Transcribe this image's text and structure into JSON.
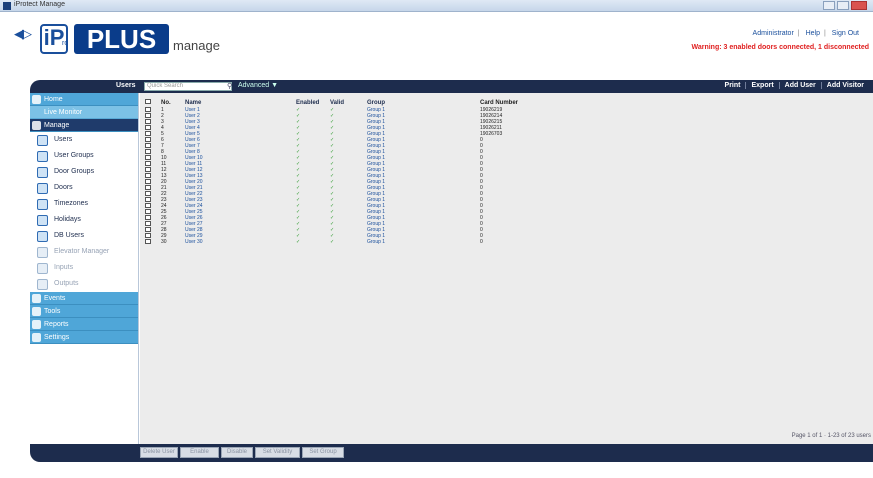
{
  "window": {
    "title": "iProtect Manage"
  },
  "header": {
    "logo_ip": "iP",
    "logo_ro": "ro",
    "logo_plus": "PLUS",
    "logo_manage": "manage",
    "links": [
      "Administrator",
      "Help",
      "Sign Out"
    ],
    "warning": "Warning: 3 enabled doors connected, 1 disconnected"
  },
  "toolbar": {
    "users_label": "Users",
    "search_placeholder": "Quick Search",
    "advanced_label": "Advanced ▼",
    "actions": [
      "Print",
      "Export",
      "Add User",
      "Add Visitor"
    ]
  },
  "sidebar": {
    "top_sections": [
      "Home",
      "Live Monitor"
    ],
    "active_section": "Manage",
    "items": [
      {
        "label": "Users",
        "icon": "users-icon",
        "dim": false
      },
      {
        "label": "User Groups",
        "icon": "user-groups-icon",
        "dim": false
      },
      {
        "label": "Door Groups",
        "icon": "door-groups-icon",
        "dim": false
      },
      {
        "label": "Doors",
        "icon": "doors-icon",
        "dim": false
      },
      {
        "label": "Timezones",
        "icon": "clock-icon",
        "dim": false
      },
      {
        "label": "Holidays",
        "icon": "calendar-icon",
        "dim": false
      },
      {
        "label": "DB Users",
        "icon": "db-users-icon",
        "dim": false
      },
      {
        "label": "Elevator Manager",
        "icon": "elevator-icon",
        "dim": true
      },
      {
        "label": "Inputs",
        "icon": "inputs-icon",
        "dim": true
      },
      {
        "label": "Outputs",
        "icon": "outputs-icon",
        "dim": true
      }
    ],
    "bottom_sections": [
      "Events",
      "Tools",
      "Reports",
      "Settings"
    ]
  },
  "grid": {
    "headers": {
      "no": "No.",
      "name": "Name",
      "enabled": "Enabled",
      "valid": "Valid",
      "group": "Group",
      "card": "Card Number"
    },
    "rows": [
      {
        "no": "1",
        "name": "User 1",
        "enabled": "✓",
        "valid": "✓",
        "group": "Group 1",
        "card": "19026219"
      },
      {
        "no": "2",
        "name": "User 2",
        "enabled": "✓",
        "valid": "✓",
        "group": "Group 1",
        "card": "19026214"
      },
      {
        "no": "3",
        "name": "User 3",
        "enabled": "✓",
        "valid": "✓",
        "group": "Group 1",
        "card": "19026215"
      },
      {
        "no": "4",
        "name": "User 4",
        "enabled": "✓",
        "valid": "✓",
        "group": "Group 1",
        "card": "19026211"
      },
      {
        "no": "5",
        "name": "User 5",
        "enabled": "✓",
        "valid": "✓",
        "group": "Group 1",
        "card": "19026703"
      },
      {
        "no": "6",
        "name": "User 6",
        "enabled": "✓",
        "valid": "✓",
        "group": "Group 1",
        "card": "0"
      },
      {
        "no": "7",
        "name": "User 7",
        "enabled": "✓",
        "valid": "✓",
        "group": "Group 1",
        "card": "0"
      },
      {
        "no": "8",
        "name": "User 8",
        "enabled": "✓",
        "valid": "✓",
        "group": "Group 1",
        "card": "0"
      },
      {
        "no": "10",
        "name": "User 10",
        "enabled": "✓",
        "valid": "✓",
        "group": "Group 1",
        "card": "0"
      },
      {
        "no": "11",
        "name": "User 11",
        "enabled": "✓",
        "valid": "✓",
        "group": "Group 1",
        "card": "0"
      },
      {
        "no": "12",
        "name": "User 12",
        "enabled": "✓",
        "valid": "✓",
        "group": "Group 1",
        "card": "0"
      },
      {
        "no": "13",
        "name": "User 13",
        "enabled": "✓",
        "valid": "✓",
        "group": "Group 1",
        "card": "0"
      },
      {
        "no": "20",
        "name": "User 20",
        "enabled": "✓",
        "valid": "✓",
        "group": "Group 1",
        "card": "0"
      },
      {
        "no": "21",
        "name": "User 21",
        "enabled": "✓",
        "valid": "✓",
        "group": "Group 1",
        "card": "0"
      },
      {
        "no": "22",
        "name": "User 22",
        "enabled": "✓",
        "valid": "✓",
        "group": "Group 1",
        "card": "0"
      },
      {
        "no": "23",
        "name": "User 23",
        "enabled": "✓",
        "valid": "✓",
        "group": "Group 1",
        "card": "0"
      },
      {
        "no": "24",
        "name": "User 24",
        "enabled": "✓",
        "valid": "✓",
        "group": "Group 1",
        "card": "0"
      },
      {
        "no": "25",
        "name": "User 25",
        "enabled": "✓",
        "valid": "✓",
        "group": "Group 1",
        "card": "0"
      },
      {
        "no": "26",
        "name": "User 26",
        "enabled": "✓",
        "valid": "✓",
        "group": "Group 1",
        "card": "0"
      },
      {
        "no": "27",
        "name": "User 27",
        "enabled": "✓",
        "valid": "✓",
        "group": "Group 1",
        "card": "0"
      },
      {
        "no": "28",
        "name": "User 28",
        "enabled": "✓",
        "valid": "✓",
        "group": "Group 1",
        "card": "0"
      },
      {
        "no": "29",
        "name": "User 29",
        "enabled": "✓",
        "valid": "✓",
        "group": "Group 1",
        "card": "0"
      },
      {
        "no": "30",
        "name": "User 30",
        "enabled": "✓",
        "valid": "✓",
        "group": "Group 1",
        "card": "0"
      }
    ],
    "pager": "Page 1 of 1 · 1-23 of 23 users"
  },
  "bottombar": {
    "buttons": [
      "Delete User",
      "Enable",
      "Disable",
      "Set Validity",
      "Set Group"
    ]
  },
  "colors": {
    "nav_dark": "#1d2c4d",
    "sidebar_light": "#4fa6d8",
    "warning": "#e02020",
    "check": "#2e9a2e",
    "link": "#1a4f9c"
  }
}
